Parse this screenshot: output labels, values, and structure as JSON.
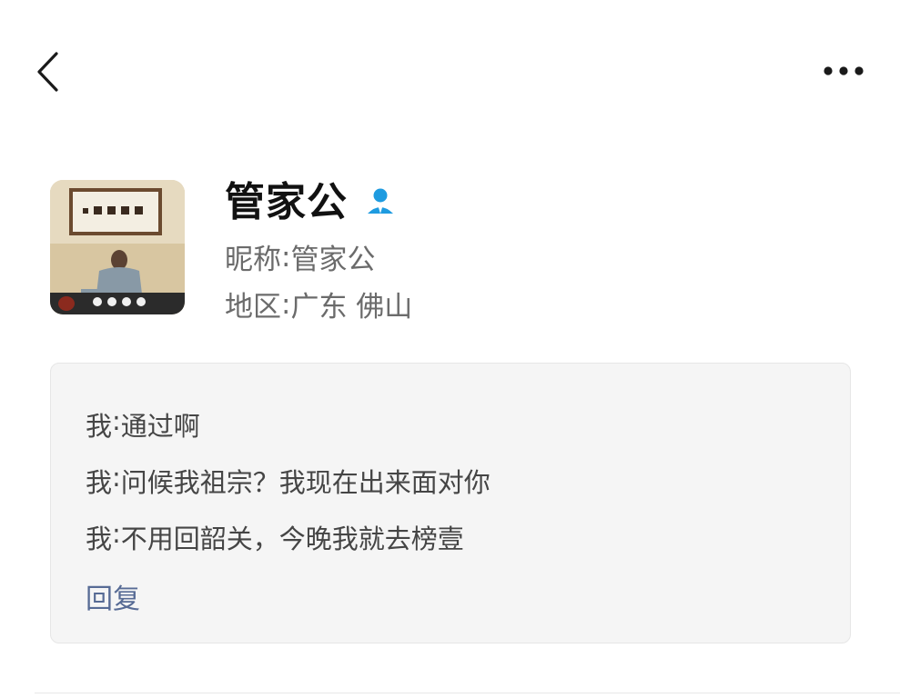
{
  "nav": {
    "back_icon": "chevron-left-icon",
    "more_icon": "more-horizontal-icon"
  },
  "profile": {
    "display_name": "管家公",
    "contact_icon": "contact-person-icon",
    "contact_icon_color": "#1e9be0",
    "nickname_label": "昵称",
    "nickname_value": "管家公",
    "region_label": "地区",
    "region_value": "广东 佛山",
    "separator": ":"
  },
  "messages": {
    "items": [
      {
        "sender": "我",
        "text": "通过啊"
      },
      {
        "sender": "我",
        "text": "问候我祖宗？我现在出来面对你"
      },
      {
        "sender": "我",
        "text": "不用回韶关，今晚我就去榜壹"
      }
    ],
    "reply_label": "回复",
    "reply_color": "#576b95"
  }
}
